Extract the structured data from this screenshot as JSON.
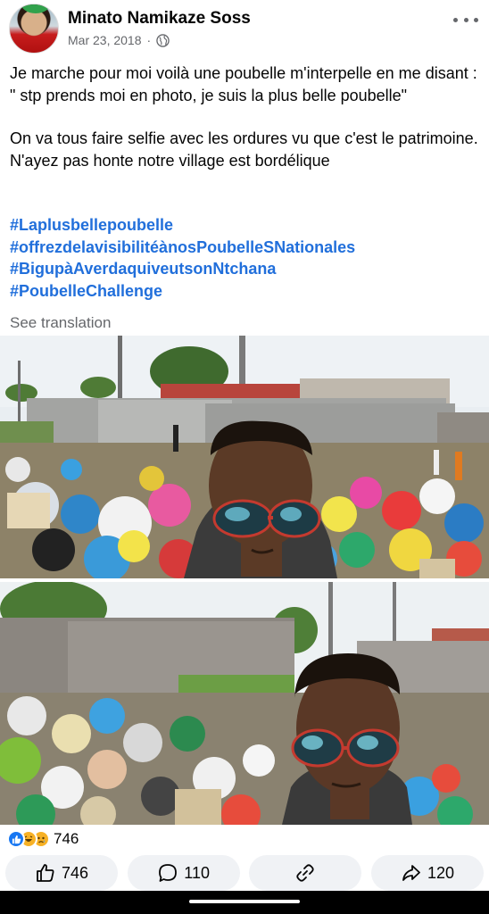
{
  "post": {
    "author": "Minato Namikaze Soss",
    "date": "Mar 23, 2018",
    "separator": "·",
    "privacy_icon": "globe-icon",
    "paragraph1": "Je marche pour moi voilà une poubelle m'interpelle en me disant : \" stp prends moi en photo, je suis la plus belle poubelle\"",
    "paragraph2": "On va tous faire selfie avec les ordures vu que c'est le patrimoine. N'ayez pas honte notre village est bordélique",
    "hashtags": [
      "#Laplusbellepoubelle",
      "#offrezdelavisibilitéànosPoubelleSNationales",
      "#BigupàAverdaquiveutsonNtchana",
      "#PoubelleChallenge"
    ],
    "see_translation": "See translation"
  },
  "engagement": {
    "reaction_icons": [
      "like-icon",
      "haha-icon",
      "sad-icon"
    ],
    "reaction_count": "746",
    "like_count": "746",
    "comment_count": "110",
    "share_count": "120"
  },
  "colors": {
    "hashtag": "#216fdb",
    "like_blue": "#1877f2",
    "secondary_text": "#65676b",
    "button_bg": "#f0f2f5"
  }
}
